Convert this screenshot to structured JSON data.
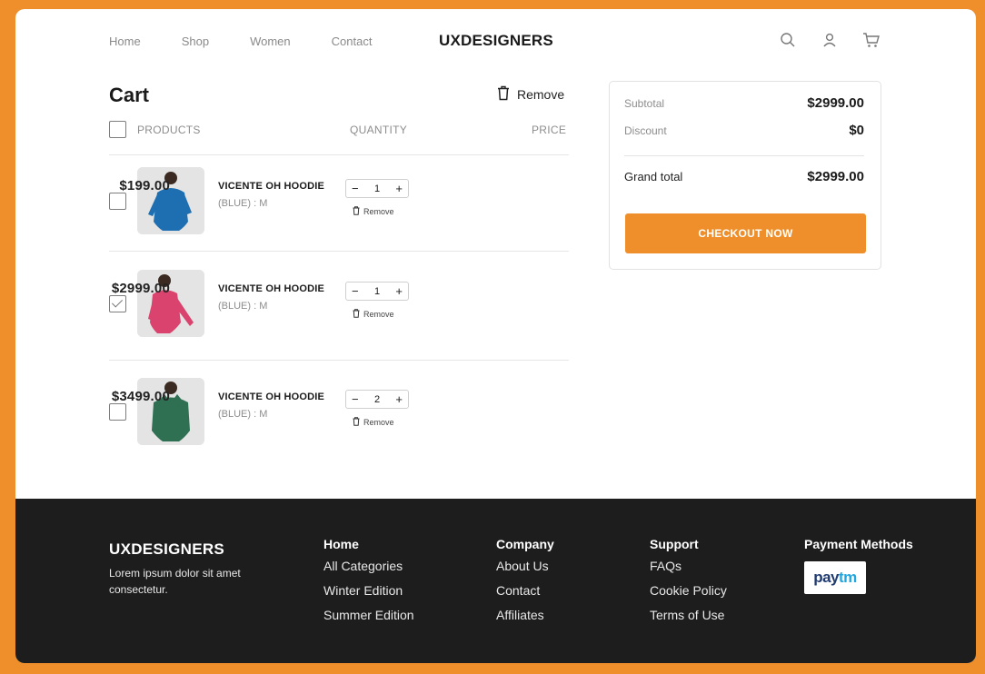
{
  "nav": {
    "items": [
      "Home",
      "Shop",
      "Women",
      "Contact"
    ],
    "brand": "UXDESIGNERS",
    "icons": [
      "search-icon",
      "user-icon",
      "cart-icon"
    ]
  },
  "cart": {
    "title": "Cart",
    "remove_label": "Remove",
    "columns": {
      "products": "PRODUCTS",
      "quantity": "QUANTITY",
      "price": "PRICE"
    },
    "items": [
      {
        "name": "VICENTE OH HOODIE",
        "variant": "(BLUE) : M",
        "qty": "1",
        "price": "$199.00",
        "checked": false,
        "remove": "Remove",
        "minus": "−",
        "plus": "+"
      },
      {
        "name": "VICENTE OH HOODIE",
        "variant": "(BLUE) : M",
        "qty": "1",
        "price": "$2999.00",
        "checked": true,
        "remove": "Remove",
        "minus": "−",
        "plus": "+"
      },
      {
        "name": "VICENTE OH HOODIE",
        "variant": "(BLUE) : M",
        "qty": "2",
        "price": "$3499.00",
        "checked": false,
        "remove": "Remove",
        "minus": "−",
        "plus": "+"
      }
    ]
  },
  "summary": {
    "subtotal_label": "Subtotal",
    "subtotal_value": "$2999.00",
    "discount_label": "Discount",
    "discount_value": "$0",
    "grand_label": "Grand total",
    "grand_value": "$2999.00",
    "checkout_label": "CHECKOUT NOW"
  },
  "footer": {
    "brand": "UXDESIGNERS",
    "description": "Lorem ipsum dolor sit amet consectetur.",
    "columns": [
      {
        "title": "Home",
        "links": [
          "All Categories",
          "Winter Edition",
          "Summer Edition"
        ]
      },
      {
        "title": "Company",
        "links": [
          "About Us",
          "Contact",
          "Affiliates"
        ]
      },
      {
        "title": "Support",
        "links": [
          "FAQs",
          "Cookie Policy",
          "Terms of Use"
        ]
      }
    ],
    "payment_title": "Payment Methods",
    "payment_logo_left": "pay",
    "payment_logo_right": "tm"
  },
  "colors": {
    "accent": "#ee8f2c",
    "footer_bg": "#1d1d1d",
    "paytm_dark": "#203b70",
    "paytm_light": "#21a7e0",
    "hoodie_blue": "#1e6fb1",
    "hoodie_pink": "#d9436e",
    "hoodie_green": "#2f6f52"
  }
}
